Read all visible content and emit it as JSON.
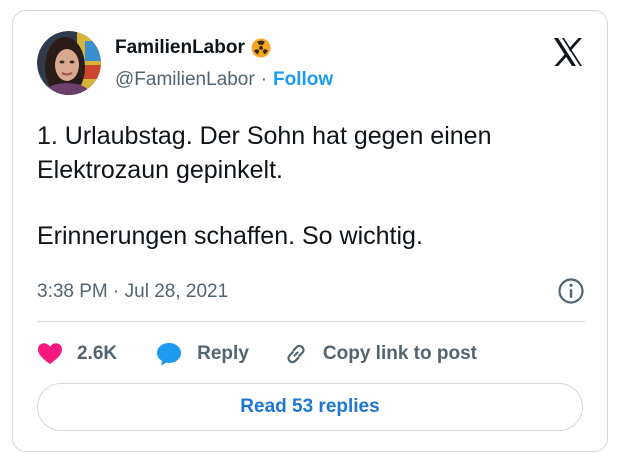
{
  "author": {
    "display_name": "FamilienLabor",
    "handle": "@FamilienLabor",
    "separator": "·",
    "follow_label": "Follow"
  },
  "tweet": {
    "line1": "1. Urlaubstag. Der Sohn hat gegen einen Elektrozaun gepinkelt.",
    "line2": "Erinnerungen schaffen. So wichtig.",
    "timestamp": "3:38 PM · Jul 28, 2021"
  },
  "actions": {
    "like_count": "2.6K",
    "reply_label": "Reply",
    "copy_label": "Copy link to post"
  },
  "replies_button": "Read 53 replies",
  "icons": {
    "verified_badge": "radioactive-icon",
    "brand": "x-logo-icon",
    "info": "info-icon",
    "like": "heart-icon",
    "reply": "speech-bubble-icon",
    "copy": "link-icon"
  },
  "colors": {
    "accent": "#1d9bf0",
    "like": "#f91880",
    "text": "#0f1419",
    "muted": "#536471",
    "border": "#cfd9de"
  }
}
